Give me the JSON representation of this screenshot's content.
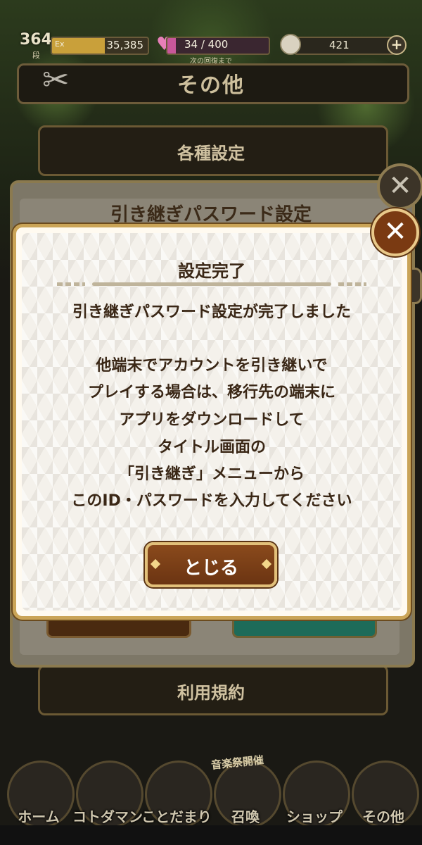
{
  "status": {
    "level": "364",
    "level_sub": "段",
    "exp_label": "Ex",
    "exp_value": "35,385",
    "exp_progress": 0.55,
    "heart_value": "34 / 400",
    "heart_sub": "次の回復まで",
    "heart_progress": 0.08,
    "coin_value": "421"
  },
  "header": {
    "title": "その他"
  },
  "background_menu": {
    "item1": "各種設定",
    "item2": "利用規約"
  },
  "underlying_panel": {
    "title": "引き継ぎパスワード設定"
  },
  "dialog": {
    "title": "設定完了",
    "line1": "引き継ぎパスワード設定が完了しました",
    "body": [
      "他端末でアカウントを引き継いで",
      "プレイする場合は、移行先の端末に",
      "アプリをダウンロードして",
      "タイトル画面の",
      "「引き継ぎ」メニューから",
      "このID・パスワードを入力してください"
    ],
    "close_label": "とじる",
    "close_icon": "✕"
  },
  "nav": {
    "badge": "音楽祭開催",
    "items": [
      "ホーム",
      "コトダマン",
      "ことだまり",
      "召喚",
      "ショップ",
      "その他"
    ]
  },
  "colors": {
    "accent_gold": "#caa457",
    "button_brown": "#7a3a12",
    "text_dark": "#3a2716"
  }
}
